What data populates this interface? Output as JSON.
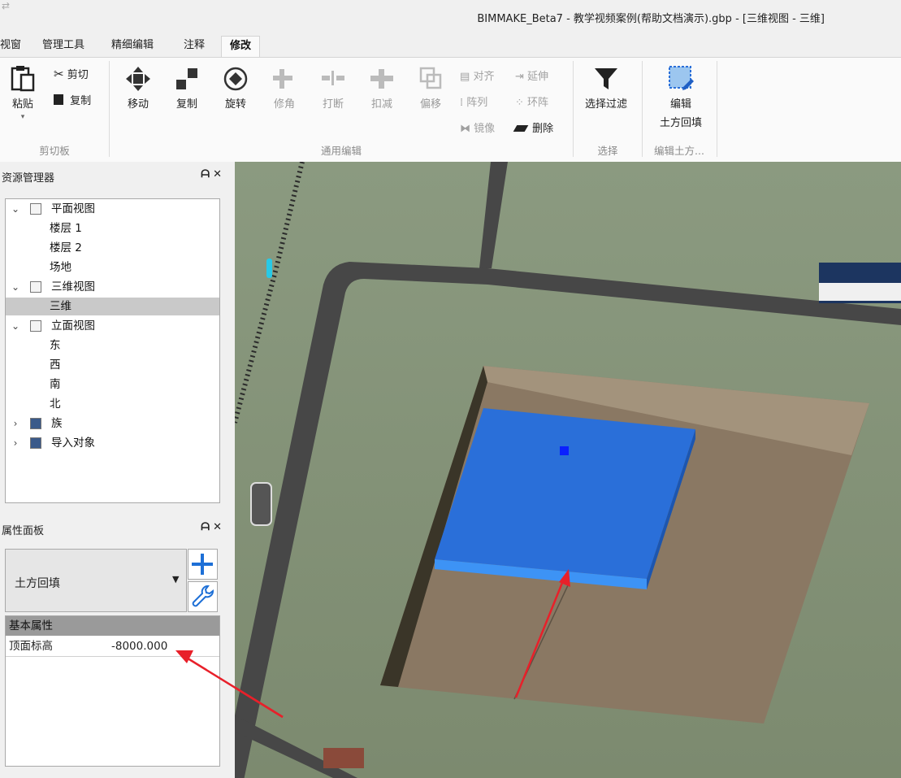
{
  "window": {
    "title": "BIMMAKE_Beta7 - 教学视频案例(帮助文档演示).gbp - [三维视图 - 三维]"
  },
  "tabs": [
    {
      "label": "视窗"
    },
    {
      "label": "管理工具"
    },
    {
      "label": "精细编辑"
    },
    {
      "label": "注释"
    },
    {
      "label": "修改",
      "active": true
    }
  ],
  "ribbon": {
    "clipboard": {
      "paste": "粘贴",
      "cut": "剪切",
      "copy": "复制",
      "group": "剪切板"
    },
    "edit": {
      "move": "移动",
      "copy": "复制",
      "rotate": "旋转",
      "trim": "修角",
      "break": "打断",
      "subtract": "扣减",
      "offset": "偏移",
      "align": "对齐",
      "extend": "延伸",
      "array": "阵列",
      "ring_array": "环阵",
      "mirror": "镜像",
      "delete": "删除",
      "group": "通用编辑"
    },
    "select": {
      "filter": "选择过滤",
      "group": "选择"
    },
    "earthwork": {
      "edit_line1": "编辑",
      "edit_line2": "土方回填",
      "group": "编辑土方..."
    }
  },
  "resource_manager": {
    "title": "资源管理器",
    "tree": [
      {
        "label": "平面视图",
        "level": 0,
        "expanded": true
      },
      {
        "label": "楼层 1",
        "level": 1
      },
      {
        "label": "楼层 2",
        "level": 1
      },
      {
        "label": "场地",
        "level": 1
      },
      {
        "label": "三维视图",
        "level": 0,
        "expanded": true
      },
      {
        "label": "三维",
        "level": 1,
        "selected": true
      },
      {
        "label": "立面视图",
        "level": 0,
        "expanded": true
      },
      {
        "label": "东",
        "level": 1
      },
      {
        "label": "西",
        "level": 1
      },
      {
        "label": "南",
        "level": 1
      },
      {
        "label": "北",
        "level": 1
      },
      {
        "label": "族",
        "level": 0,
        "expanded": false
      },
      {
        "label": "导入对象",
        "level": 0,
        "expanded": false
      }
    ]
  },
  "properties": {
    "title": "属性面板",
    "type": "土方回填",
    "section": "基本属性",
    "rows": [
      {
        "name": "顶面标高",
        "value": "-8000.000"
      }
    ]
  },
  "colors": {
    "ground": "#7f8e72",
    "road": "#4a4a4a",
    "fill_top": "#2a6fd9",
    "fill_edge": "#3d93f5",
    "pit": "#9a8a73",
    "annotation": "#e8202a",
    "accent_tab": "#1d6fd6"
  }
}
